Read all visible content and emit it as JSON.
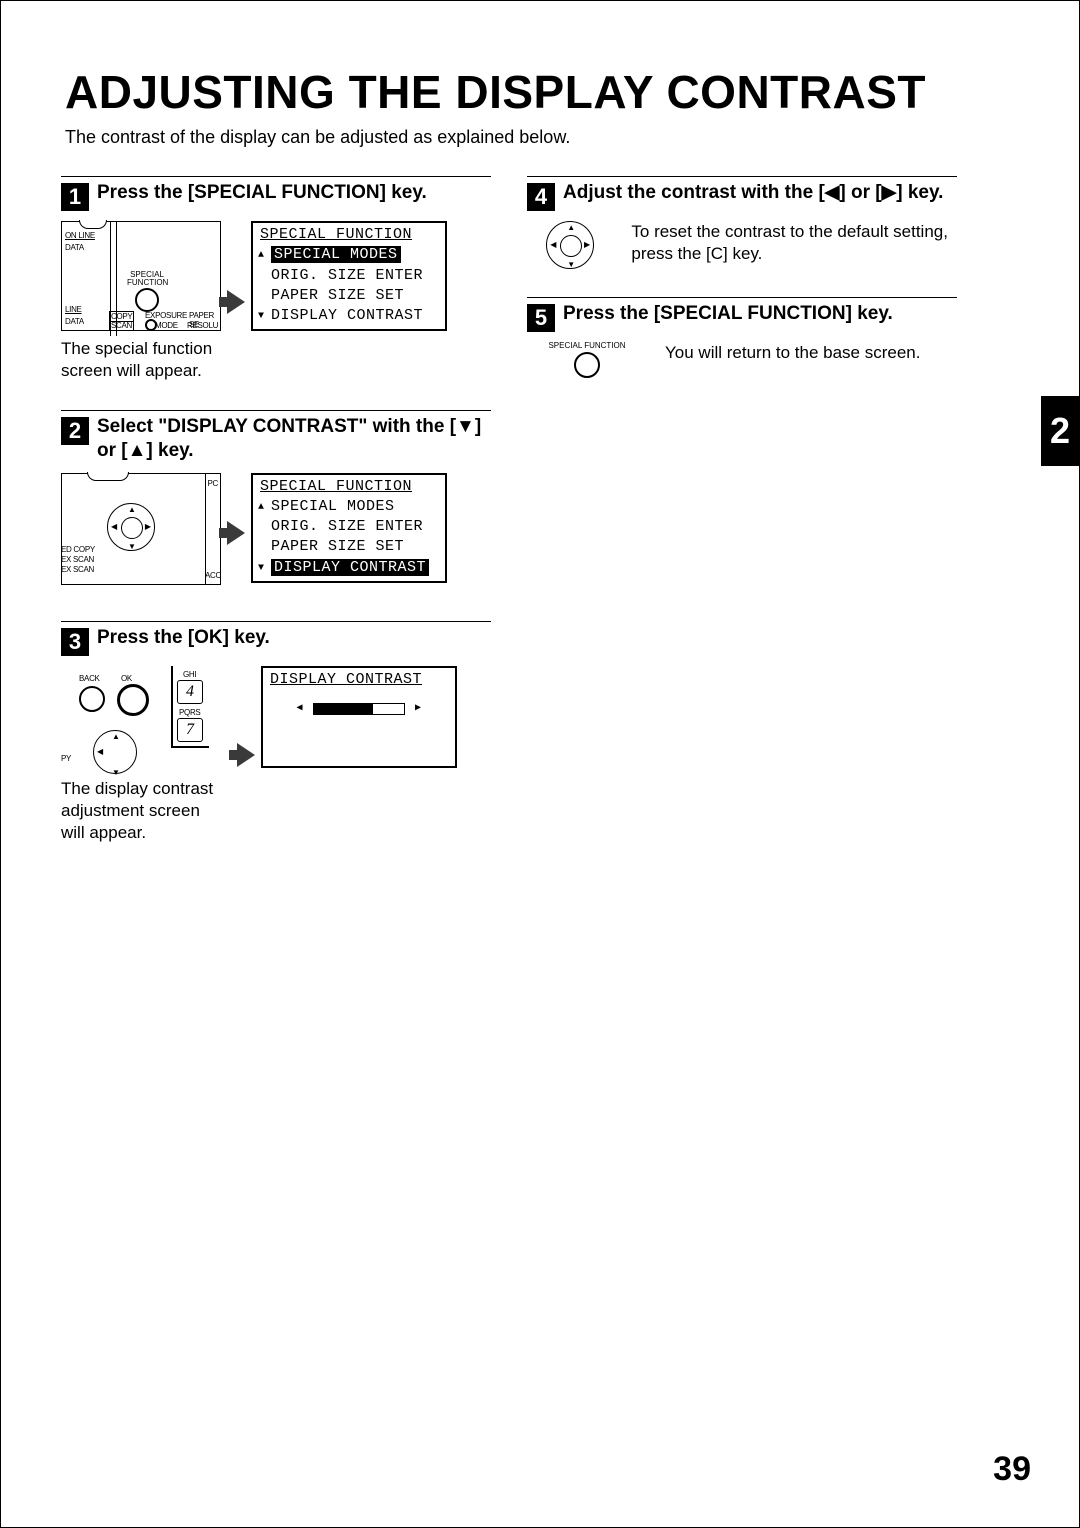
{
  "title": "ADJUSTING THE DISPLAY CONTRAST",
  "intro": "The contrast of the display can be adjusted as explained below.",
  "section_tab": "2",
  "page_number": "39",
  "steps": {
    "s1": {
      "num": "1",
      "title": "Press the [SPECIAL FUNCTION] key.",
      "caption": "The special function screen will appear.",
      "panel": {
        "online": "ON LINE",
        "data1": "DATA",
        "line": "LINE",
        "data2": "DATA",
        "sf": "SPECIAL FUNCTION",
        "copy": "COPY",
        "scan": "SCAN",
        "exposure": "EXPOSURE",
        "paper": "PAPER SE",
        "mode": "MODE",
        "resolu": "RESOLU"
      },
      "lcd": {
        "title": "SPECIAL FUNCTION",
        "l1": "SPECIAL MODES",
        "l2": "ORIG. SIZE ENTER",
        "l3": "PAPER SIZE SET",
        "l4": "DISPLAY CONTRAST"
      }
    },
    "s2": {
      "num": "2",
      "title": "Select \"DISPLAY CONTRAST\" with the [▼] or [▲] key.",
      "panel": {
        "edcopy": "ED COPY",
        "exscan1": "EX SCAN",
        "exscan2": "EX SCAN",
        "pc": "PC",
        "acc": "ACC"
      },
      "lcd": {
        "title": "SPECIAL FUNCTION",
        "l1": "SPECIAL MODES",
        "l2": "ORIG. SIZE ENTER",
        "l3": "PAPER SIZE SET",
        "l4": "DISPLAY CONTRAST"
      }
    },
    "s3": {
      "num": "3",
      "title": "Press the [OK] key.",
      "caption": "The display contrast adjustment screen will appear.",
      "panel": {
        "back": "BACK",
        "ok": "OK",
        "ghi": "GHI",
        "k4": "4",
        "pqrs": "PQRS",
        "k7": "7",
        "py": "PY"
      },
      "lcd": {
        "title": "DISPLAY CONTRAST"
      }
    },
    "s4": {
      "num": "4",
      "title": "Adjust the contrast with the [◀] or [▶] key.",
      "body": "To reset the contrast to the default setting, press the [C] key."
    },
    "s5": {
      "num": "5",
      "title": "Press the [SPECIAL FUNCTION] key.",
      "body": "You will return to the base screen.",
      "sf": "SPECIAL FUNCTION"
    }
  }
}
